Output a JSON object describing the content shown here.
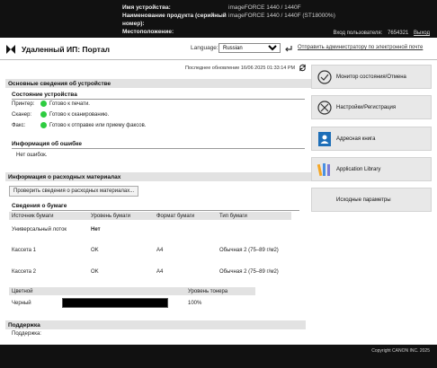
{
  "header": {
    "device_name_label": "Имя устройства:",
    "device_name_value": "imageFORCE 1440 / 1440F",
    "product_label": "Наименование продукта (серийный номер):",
    "product_value": "imageFORCE 1440 / 1440F (ST18000%)",
    "location_label": "Местоположение:",
    "location_value": "",
    "login_label": "Вход пользователя:",
    "login_user": "7654321",
    "logout": "Выход"
  },
  "titlebar": {
    "title": "Удаленный ИП: Портал",
    "language_label": "Language:",
    "language_value": "Russian",
    "send_link": "Отправить администратору по электронной почте"
  },
  "main": {
    "last_update": "Последнее обновление 16/06 2025 01:33:14 PM",
    "basic_section": "Основные сведения об устройстве",
    "device_status_title": "Состояние устройства",
    "statuses": [
      {
        "label": "Принтер:",
        "value": "Готово к печати."
      },
      {
        "label": "Сканер:",
        "value": "Готово к сканированию."
      },
      {
        "label": "Факс:",
        "value": "Готово к отправке или приему факсов."
      }
    ],
    "error_title": "Информация об ошибке",
    "error_value": "Нет ошибок.",
    "consumables_section": "Информация о расходных материалах",
    "check_button": "Проверить сведения о расходных материалах...",
    "paper_title": "Сведения о бумаге",
    "paper_headers": [
      "Источник бумаги",
      "Уровень бумаги",
      "Формат бумаги",
      "Тип бумаги"
    ],
    "paper_rows": [
      {
        "source": "Универсальный лоток",
        "level": "Нет",
        "size": "",
        "type": ""
      },
      {
        "source": "Кассета 1",
        "level": "OK",
        "size": "A4",
        "type": "Обычная 2 (75–89 г/м2)"
      },
      {
        "source": "Кассета 2",
        "level": "OK",
        "size": "A4",
        "type": "Обычная 2 (75–89 г/м2)"
      }
    ],
    "toner_headers": [
      "Цветной",
      "",
      "Уровень тонера"
    ],
    "toner_rows": [
      {
        "color": "Черный",
        "level": "100%",
        "level_fraction": 1.0
      }
    ],
    "support_section": "Поддержка",
    "support_label": "Поддержка:"
  },
  "sidebar": {
    "items": [
      {
        "label": "Монитор состояния/Отмена",
        "icon": "status-monitor-icon"
      },
      {
        "label": "Настройки/Регистрация",
        "icon": "settings-tools-icon"
      },
      {
        "label": "Адресная книга",
        "icon": "address-book-icon"
      },
      {
        "label": "Application Library",
        "icon": "application-library-icon"
      },
      {
        "label": "Исходные параметры",
        "icon": ""
      }
    ]
  },
  "footer": {
    "copyright": "Copyright CANON INC. 2025"
  },
  "colors": {
    "status_ok": "#2ecc40",
    "header_bg": "#111111",
    "section_bg": "#e2e2e2",
    "sidebar_bg": "#e8e8e8"
  }
}
